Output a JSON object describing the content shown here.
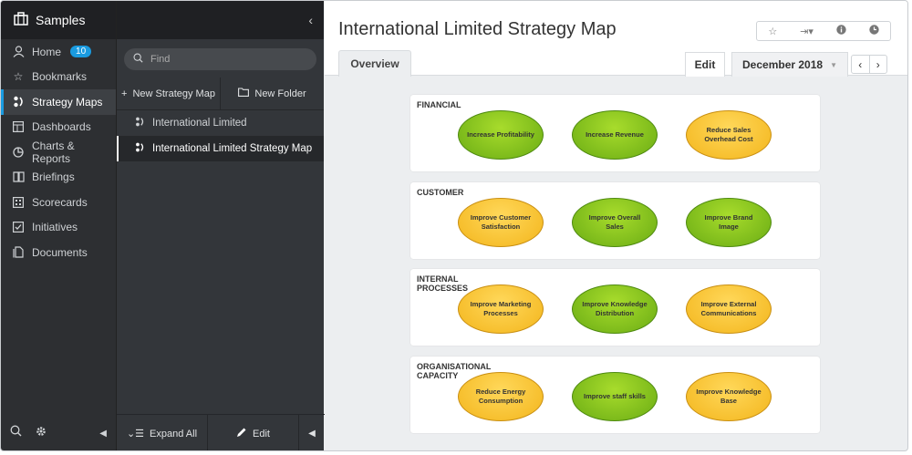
{
  "app": {
    "title": "Samples"
  },
  "sidebar": {
    "items": [
      {
        "label": "Home",
        "icon": "person-icon",
        "badge": "10"
      },
      {
        "label": "Bookmarks",
        "icon": "star-icon"
      },
      {
        "label": "Strategy Maps",
        "icon": "strategy-map-icon",
        "active": true
      },
      {
        "label": "Dashboards",
        "icon": "dashboard-icon"
      },
      {
        "label": "Charts & Reports",
        "icon": "pie-chart-icon"
      },
      {
        "label": "Briefings",
        "icon": "book-icon"
      },
      {
        "label": "Scorecards",
        "icon": "scorecard-icon"
      },
      {
        "label": "Initiatives",
        "icon": "checkbox-icon"
      },
      {
        "label": "Documents",
        "icon": "documents-icon"
      }
    ]
  },
  "tree": {
    "search_placeholder": "Find",
    "new_map_label": "New Strategy Map",
    "new_folder_label": "New Folder",
    "items": [
      "International Limited",
      "International Limited Strategy Map"
    ],
    "expand_all_label": "Expand All",
    "edit_label": "Edit"
  },
  "main": {
    "title": "International Limited Strategy Map",
    "tab_overview": "Overview",
    "tab_edit": "Edit",
    "date": "December 2018"
  },
  "perspectives": [
    {
      "label": "FINANCIAL",
      "objectives": [
        {
          "text": "Increase Profitability",
          "status": "green"
        },
        {
          "text": "Increase Revenue",
          "status": "green"
        },
        {
          "text": "Reduce Sales Overhead Cost",
          "status": "yellow"
        }
      ]
    },
    {
      "label": "CUSTOMER",
      "objectives": [
        {
          "text": "Improve Customer Satisfaction",
          "status": "yellow"
        },
        {
          "text": "Improve Overall Sales",
          "status": "green"
        },
        {
          "text": "Improve Brand Image",
          "status": "green"
        }
      ]
    },
    {
      "label": "INTERNAL\nPROCESSES",
      "objectives": [
        {
          "text": "Improve Marketing Processes",
          "status": "yellow"
        },
        {
          "text": "Improve Knowledge Distribution",
          "status": "green"
        },
        {
          "text": "Improve External Communications",
          "status": "yellow"
        }
      ]
    },
    {
      "label": "ORGANISATIONAL\nCAPACITY",
      "objectives": [
        {
          "text": "Reduce Energy Consumption",
          "status": "yellow"
        },
        {
          "text": "Improve staff skills",
          "status": "green"
        },
        {
          "text": "Improve Knowledge Base",
          "status": "yellow"
        }
      ]
    }
  ],
  "colors": {
    "accent": "#1a9be0",
    "green": "#7cc118",
    "yellow": "#f7c12a"
  }
}
